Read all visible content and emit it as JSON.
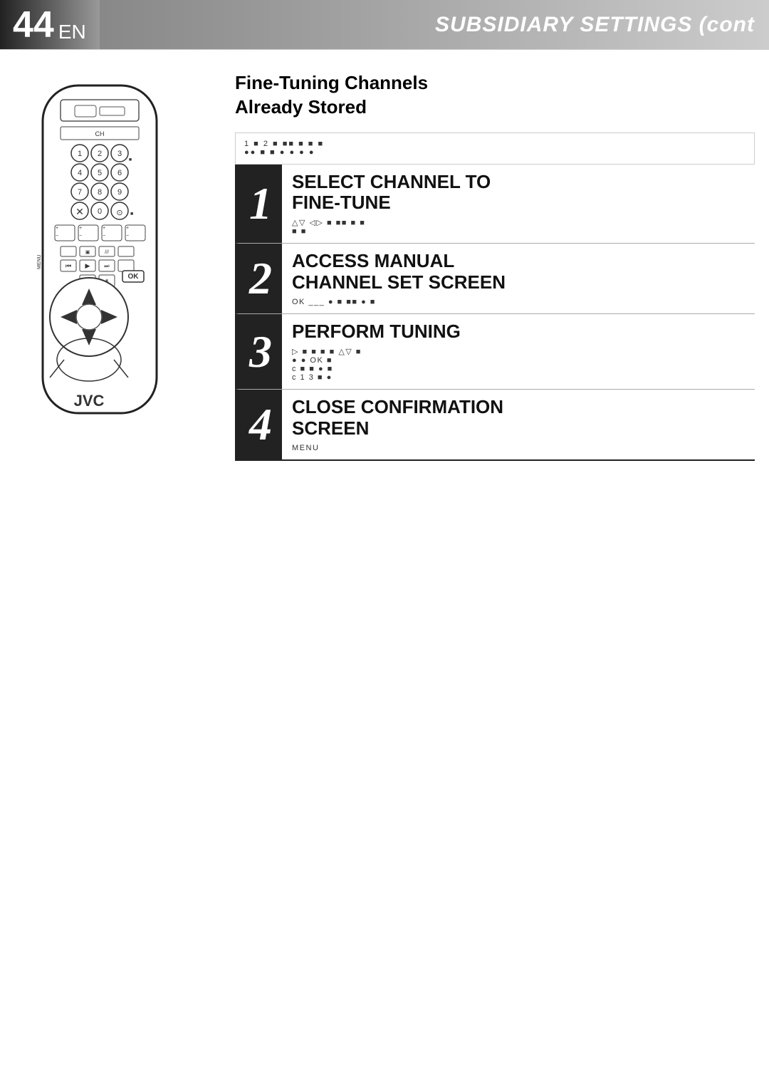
{
  "header": {
    "page_number": "44",
    "page_suffix": "EN",
    "title": "SUBSIDIARY SETTINGS (cont"
  },
  "section": {
    "title_line1": "Fine-Tuning Channels",
    "title_line2": "Already Stored"
  },
  "top_symbols": {
    "row1": "1  ■ 2       ■      ■■      ■         ■ ■",
    "row2": "●●              ■        ■ ●              ● ● ●"
  },
  "steps": [
    {
      "number": "1",
      "heading_line1": "SELECT CHANNEL TO",
      "heading_line2": "FINE-TUNE",
      "detail": "△▽ ◁▷  ■      ■■       ■        ■\n■  ■"
    },
    {
      "number": "2",
      "heading_line1": "ACCESS MANUAL",
      "heading_line2": "CHANNEL SET SCREEN",
      "detail": "OK ___  ●        ■         ■■        ●        ■"
    },
    {
      "number": "3",
      "heading_line1": "PERFORM TUNING",
      "detail": "▷  ■              ■        ■  ■   △▽  ■\n●              ●             OK  ■\nc         ■            ■ ●       ■\nc       1        3        ■ ●"
    },
    {
      "number": "4",
      "heading_line1": "CLOSE CONFIRMATION",
      "heading_line2": "SCREEN",
      "detail": "MENU"
    }
  ],
  "remote": {
    "brand": "JVC",
    "ok_label": "OK",
    "menu_label": "MENU"
  }
}
